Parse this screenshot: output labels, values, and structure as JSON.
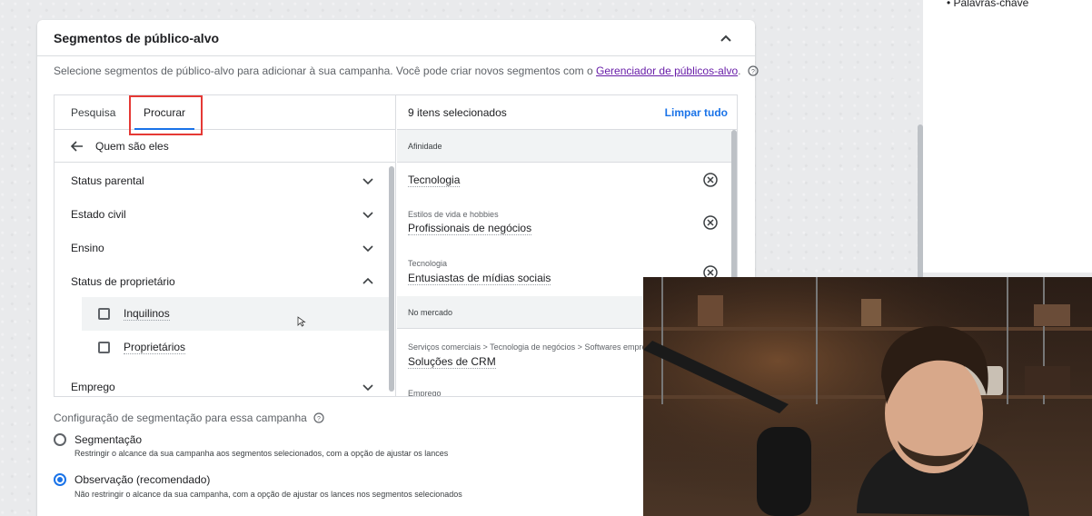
{
  "card": {
    "title": "Segmentos de público-alvo",
    "intro_text": "Selecione segmentos de público-alvo para adicionar à sua campanha. Você pode criar novos segmentos com o ",
    "intro_link": "Gerenciador de públicos-alvo",
    "intro_suffix": "."
  },
  "tabs": [
    {
      "label": "Pesquisa",
      "active": false
    },
    {
      "label": "Procurar",
      "active": true
    }
  ],
  "browse": {
    "back_label": "Quem são eles",
    "categories": [
      {
        "label": "Status parental",
        "expanded": false
      },
      {
        "label": "Estado civil",
        "expanded": false
      },
      {
        "label": "Ensino",
        "expanded": false
      },
      {
        "label": "Status de proprietário",
        "expanded": true
      },
      {
        "label": "Emprego",
        "expanded": false
      }
    ],
    "owner_options": [
      {
        "label": "Inquilinos",
        "checked": false
      },
      {
        "label": "Proprietários",
        "checked": false
      }
    ]
  },
  "selected": {
    "count_label": "9 itens selecionados",
    "clear_label": "Limpar tudo",
    "groups": [
      {
        "heading": "Afinidade",
        "items": [
          {
            "category": "",
            "name": "Tecnologia"
          },
          {
            "category": "Estilos de vida e hobbies",
            "name": "Profissionais de negócios"
          },
          {
            "category": "Tecnologia",
            "name": "Entusiastas de mídias sociais"
          }
        ]
      },
      {
        "heading": "No mercado",
        "items": [
          {
            "category": "Serviços comerciais > Tecnologia de negócios > Softwares empresariais",
            "name": "Soluções de CRM"
          }
        ]
      },
      {
        "heading": "Emprego",
        "items": []
      }
    ]
  },
  "targeting": {
    "title": "Configuração de segmentação para essa campanha",
    "options": [
      {
        "label": "Segmentação",
        "description": "Restringir o alcance da sua campanha aos segmentos selecionados, com a opção de ajustar os lances",
        "selected": false
      },
      {
        "label": "Observação (recomendado)",
        "description": "Não restringir o alcance da sua campanha, com a opção de ajustar os lances nos segmentos selecionados",
        "selected": true
      }
    ]
  },
  "side": {
    "item": "• Palavras-chave"
  },
  "colors": {
    "accent": "#1a73e8",
    "link": "#681da8",
    "highlight": "#e53935"
  },
  "icons": [
    "chevron-up-icon",
    "help-icon",
    "arrow-back-icon",
    "chevron-down-icon",
    "checkbox-icon",
    "remove-circle-icon"
  ]
}
